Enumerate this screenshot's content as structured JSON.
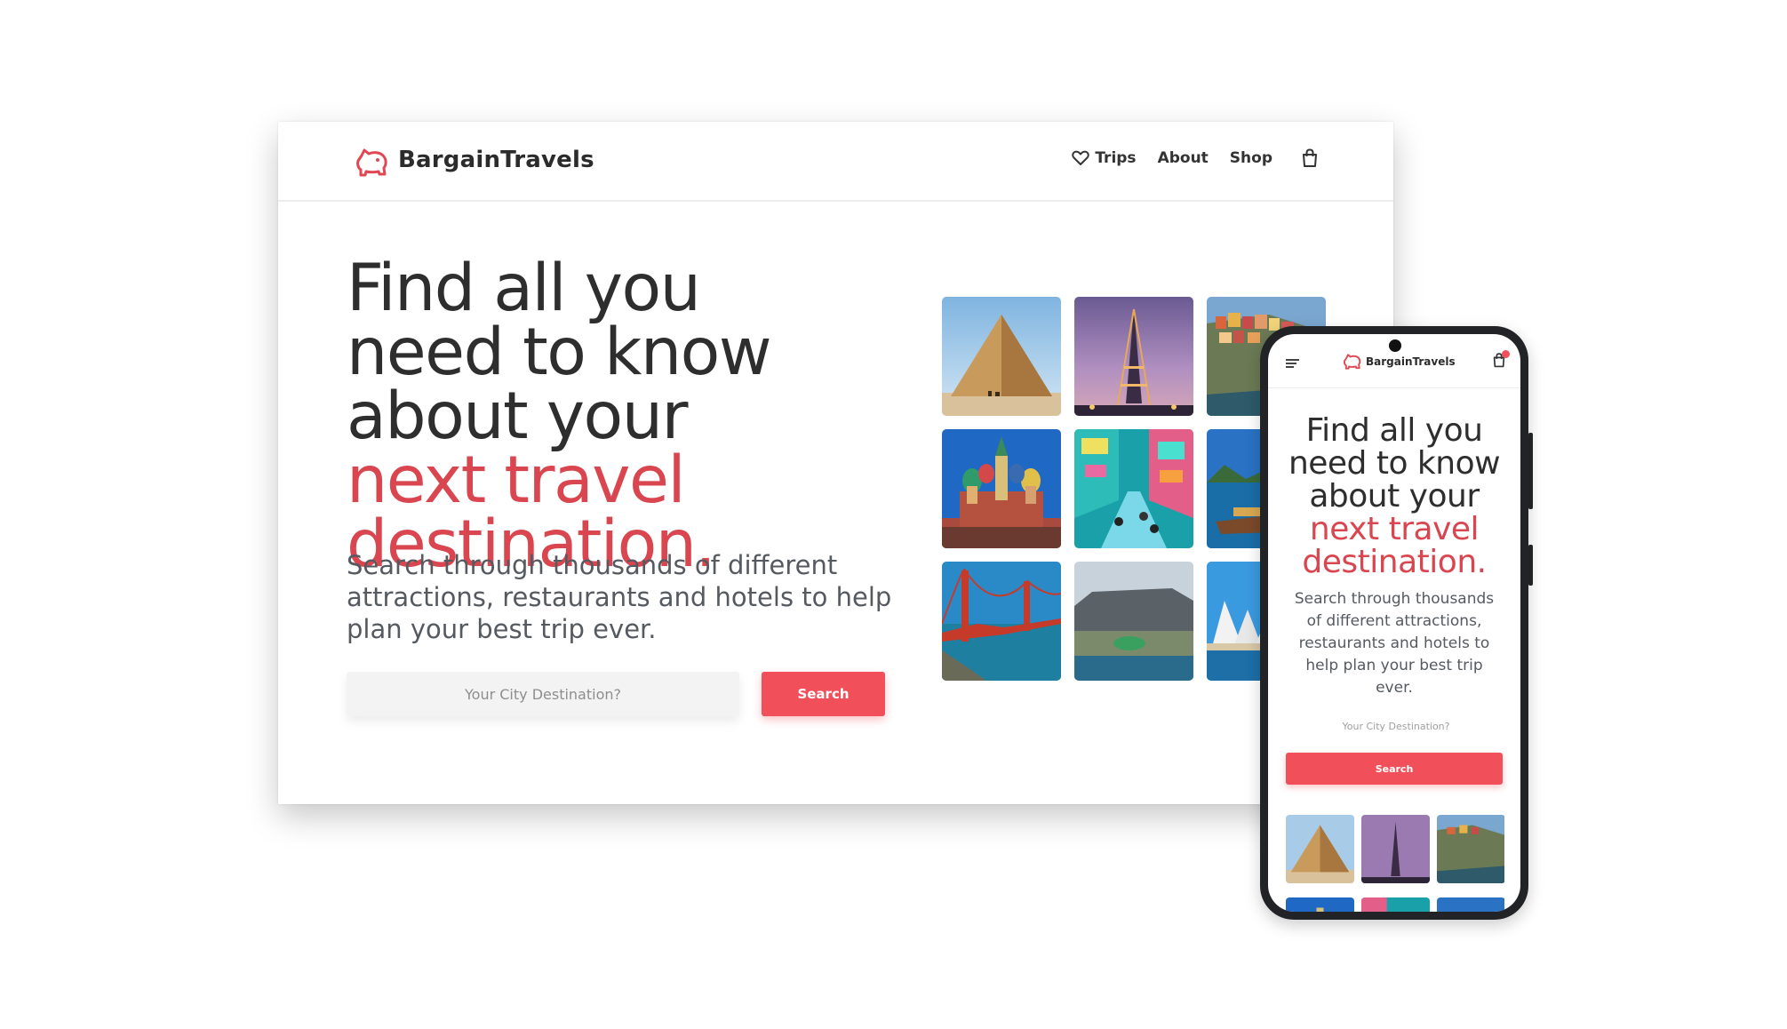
{
  "brand": {
    "name": "BargainTravels",
    "accent_color": "#f1505a",
    "logo_icon": "piggy-bank-icon"
  },
  "nav": {
    "items": [
      {
        "label": "Trips",
        "icon": "heart-icon"
      },
      {
        "label": "About"
      },
      {
        "label": "Shop"
      }
    ],
    "cart_icon": "shopping-bag-icon"
  },
  "hero": {
    "title_plain": "Find all you need to know about your ",
    "title_accent": "next travel destination.",
    "subtitle": "Search through thousands of different attractions, restaurants and hotels to help plan your best trip ever."
  },
  "search": {
    "placeholder": "Your City Destination?",
    "button_label": "Search"
  },
  "destinations": [
    {
      "name": "Pyramid of Giza",
      "icon": "pyramid-image"
    },
    {
      "name": "Eiffel Tower",
      "icon": "eiffel-tower-image"
    },
    {
      "name": "Cinque Terre",
      "icon": "cliff-village-image"
    },
    {
      "name": "Saint Basil's Cathedral",
      "icon": "cathedral-image"
    },
    {
      "name": "Times Square",
      "icon": "city-street-image"
    },
    {
      "name": "Tropical Bay",
      "icon": "bay-boat-image"
    },
    {
      "name": "Golden Gate Bridge",
      "icon": "bridge-image"
    },
    {
      "name": "Table Mountain",
      "icon": "mountain-city-image"
    },
    {
      "name": "Sydney Opera House",
      "icon": "opera-house-image"
    }
  ],
  "mobile": {
    "brand": "BargainTravels",
    "menu_icon": "hamburger-menu-icon",
    "cart_icon": "shopping-bag-icon",
    "title_plain": "Find all you need to know about your ",
    "title_accent": "next travel destination.",
    "subtitle": "Search through thousands of different attractions, restaurants and hotels to help plan your best trip ever.",
    "search_placeholder": "Your City Destination?",
    "search_button_label": "Search"
  }
}
